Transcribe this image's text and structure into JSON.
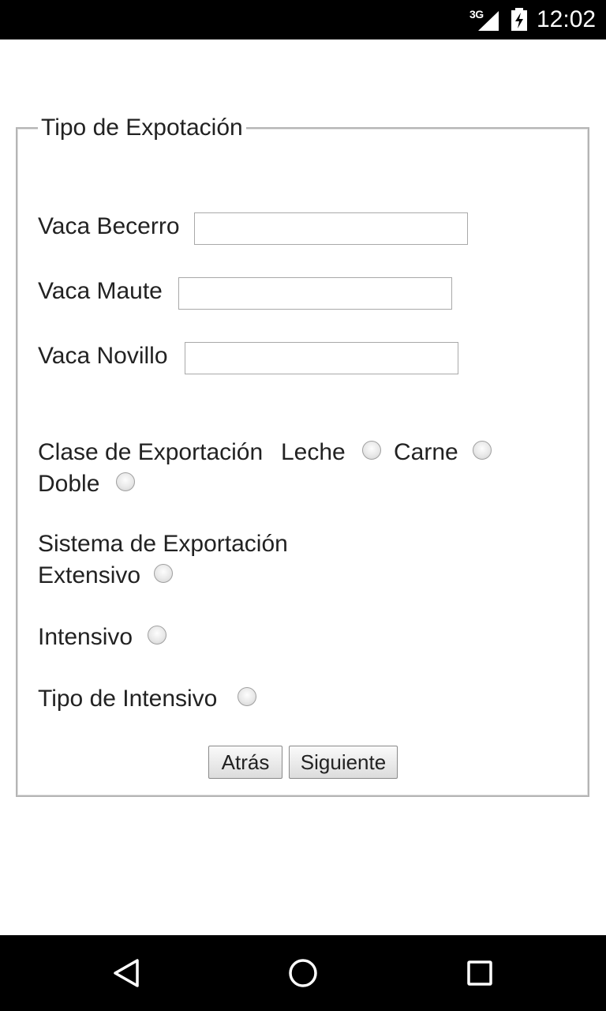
{
  "status_bar": {
    "network": "3G",
    "time": "12:02",
    "icons": [
      "signal-icon",
      "battery-charging-icon"
    ]
  },
  "form": {
    "legend": "Tipo de Expotación",
    "fields": [
      {
        "label": "Vaca Becerro",
        "value": ""
      },
      {
        "label": "Vaca Maute",
        "value": ""
      },
      {
        "label": "Vaca Novillo",
        "value": ""
      }
    ],
    "clase": {
      "label": "Clase de Exportación",
      "options": [
        "Leche",
        "Carne",
        "Doble"
      ]
    },
    "sistema": {
      "label": "Sistema de Exportación",
      "options": [
        "Extensivo",
        "Intensivo",
        "Tipo de Intensivo"
      ]
    },
    "buttons": {
      "back": "Atrás",
      "next": "Siguiente"
    }
  },
  "nav_bar": {
    "icons": [
      "back-icon",
      "home-icon",
      "recents-icon"
    ]
  }
}
